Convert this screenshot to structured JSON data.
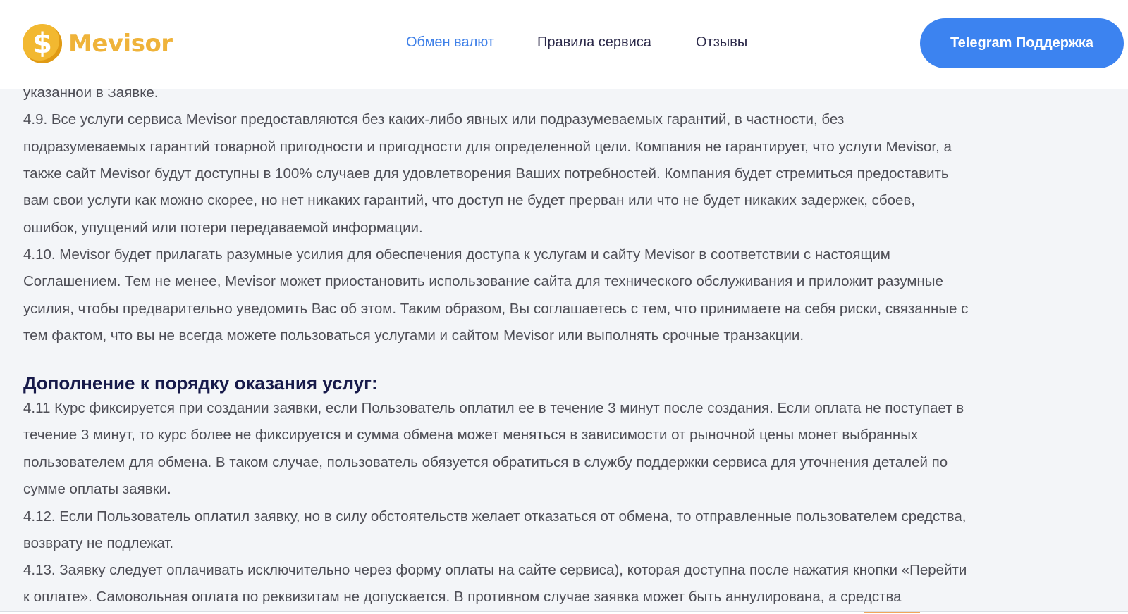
{
  "header": {
    "logo_symbol": "$",
    "brand": "Mevisor",
    "nav": [
      "Обмен валют",
      "Правила сервиса",
      "Отзывы"
    ],
    "support_button": "Telegram Поддержка"
  },
  "content": {
    "lines": [
      "указанной в Заявке.",
      "4.9. Все услуги сервиса Mevisor предоставляются без каких-либо явных или подразумеваемых гарантий, в частности, без",
      "подразумеваемых гарантий товарной пригодности и пригодности для определенной цели. Компания не гарантирует, что услуги Mevisor, а",
      "также сайт Mevisor будут доступны в 100% случаев для удовлетворения Ваших потребностей. Компания будет стремиться предоставить",
      "вам свои услуги как можно скорее, но нет никаких гарантий, что доступ не будет прерван или что не будет никаких задержек, сбоев,",
      "ошибок, упущений или потери передаваемой информации.",
      "4.10. Mevisor будет прилагать разумные усилия для обеспечения доступа к услугам и сайту Mevisor в соответствии с настоящим",
      "Соглашением. Тем не менее, Mevisor может приостановить использование сайта для технического обслуживания и приложит разумные",
      "усилия, чтобы предварительно уведомить Вас об этом. Таким образом, Вы соглашаетесь с тем, что принимаете на себя риски, связанные с",
      "тем фактом, что вы не всегда можете пользоваться услугами и сайтом Mevisor или выполнять срочные транзакции."
    ],
    "heading": "Дополнение к порядку оказания услуг:",
    "lines2": [
      "4.11 Курс фиксируется при создании заявки, если Пользователь оплатил ее в течение 3 минут после создания. Если оплата не поступает в",
      "течение 3 минут, то курс более не фиксируется и сумма обмена может меняться в зависимости от рыночной цены монет выбранных",
      "пользователем для обмена. В таком случае, пользователь обязуется обратиться в службу поддержки сервиса для уточнения деталей по",
      "сумме оплаты заявки.",
      "4.12. Если Пользователь оплатил заявку, но в силу обстоятельств желает отказаться от обмена, то отправленные пользователем средства,",
      "возврату не подлежат.",
      "4.13. Заявку следует оплачивать исключительно через форму оплаты на сайте сервиса), которая доступна после нажатия кнопки «Перейти",
      "к оплате». Самовольная оплата по реквизитам не допускается. В противном случае заявка может быть аннулирована, а средства"
    ]
  }
}
